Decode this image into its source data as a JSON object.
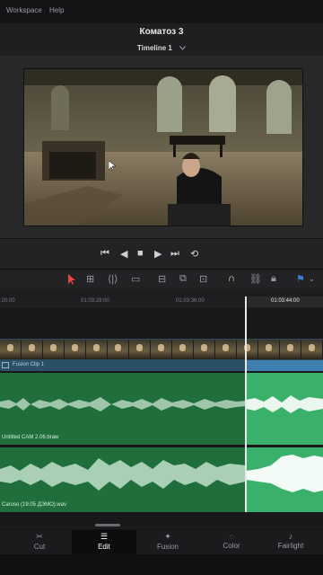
{
  "menubar": {
    "items": [
      "Workspace",
      "Help"
    ]
  },
  "project": {
    "title": "Коматоз 3"
  },
  "timeline": {
    "name": "Timeline 1"
  },
  "transport": {
    "buttons": [
      "skip-to-start",
      "step-back",
      "stop",
      "play",
      "skip-to-end",
      "loop"
    ]
  },
  "toolbar": {
    "tools": [
      "selection",
      "trim",
      "dynamic-trim",
      "blade",
      "insert",
      "overwrite",
      "replace",
      "snapping",
      "linked-selection",
      "position-lock",
      "flag"
    ]
  },
  "ruler": {
    "timecodes": [
      ":20:00",
      "01:03:28:00",
      "01:03:36:00",
      "01:03:44:00"
    ],
    "playhead_timecode": "01:03:44:00"
  },
  "tracks": {
    "video_clip_label": "Fusion Clip 1",
    "audio_1_label": "Untitled CAM 2.06.braw",
    "audio_2_label": "Caruso (19.05 ДЭМО).wav"
  },
  "nav": {
    "items": [
      {
        "label": "Cut",
        "icon": "cut-page-icon"
      },
      {
        "label": "Edit",
        "icon": "edit-page-icon"
      },
      {
        "label": "Fusion",
        "icon": "fusion-page-icon"
      },
      {
        "label": "Color",
        "icon": "color-page-icon"
      },
      {
        "label": "Fairlight",
        "icon": "fairlight-page-icon"
      }
    ],
    "active": "Edit"
  },
  "colors": {
    "accent": "#d7265a",
    "audio_track": "#1f6e3c",
    "audio_track_selected": "#39b16a",
    "video_track": "#2f4a5a"
  }
}
